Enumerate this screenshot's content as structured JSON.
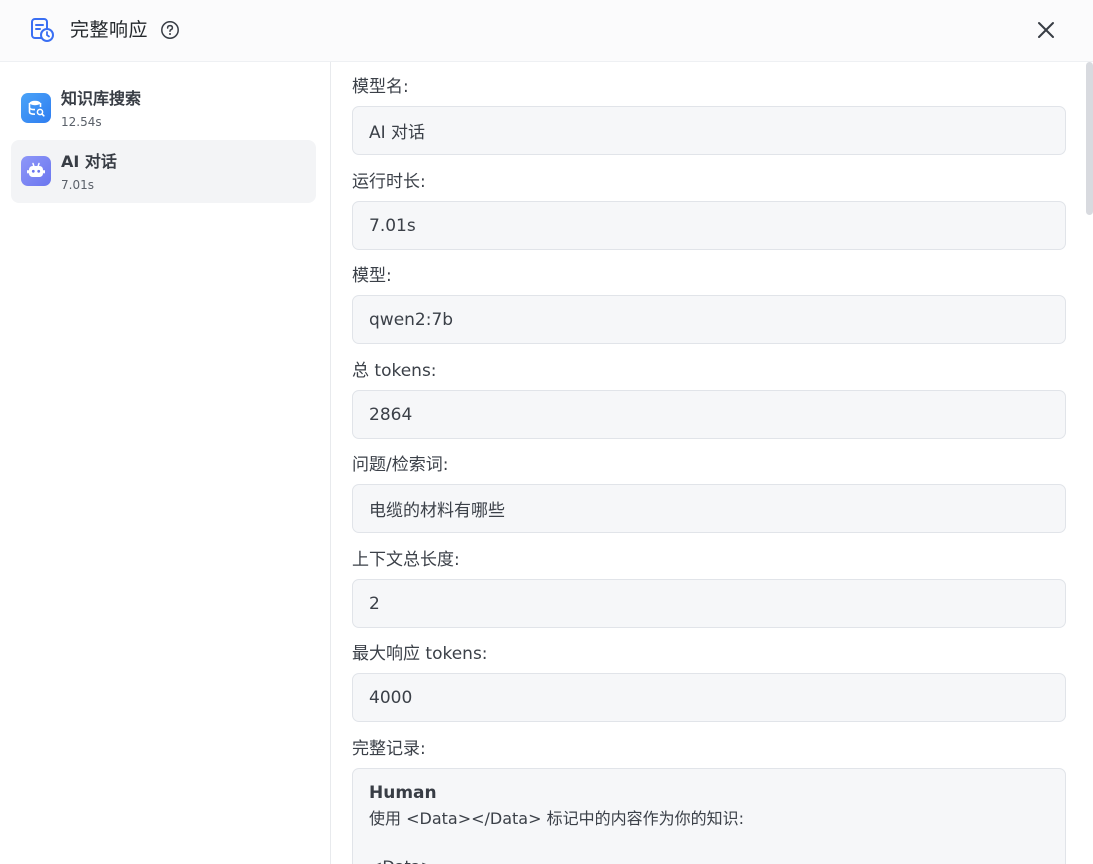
{
  "header": {
    "title": "完整响应",
    "icons": {
      "app": "file-clock-icon",
      "help": "question-circle-icon",
      "close": "close-icon"
    }
  },
  "sidebar": {
    "items": [
      {
        "name": "知识库搜索",
        "time": "12.54s",
        "icon": "database-search-icon",
        "icon_color": "#3a8bf5",
        "active": false
      },
      {
        "name": "AI 对话",
        "time": "7.01s",
        "icon": "robot-icon",
        "icon_color": "#7b86f5",
        "active": true
      }
    ]
  },
  "fields": [
    {
      "label": "模型名:",
      "value": "AI 对话"
    },
    {
      "label": "运行时长:",
      "value": "7.01s"
    },
    {
      "label": "模型:",
      "value": "qwen2:7b"
    },
    {
      "label": "总 tokens:",
      "value": "2864"
    },
    {
      "label": "问题/检索词:",
      "value": "电缆的材料有哪些"
    },
    {
      "label": "上下文总长度:",
      "value": "2"
    },
    {
      "label": "最大响应 tokens:",
      "value": "4000"
    }
  ],
  "history": {
    "label": "完整记录:",
    "role": "Human",
    "text": "使用 <Data></Data> 标记中的内容作为你的知识:",
    "next_line": "<Data>"
  },
  "colors": {
    "accent": "#3a6ff3",
    "field_bg": "#f6f7f9",
    "field_border": "#e1e4e9",
    "active_item_bg": "#f3f4f6"
  }
}
